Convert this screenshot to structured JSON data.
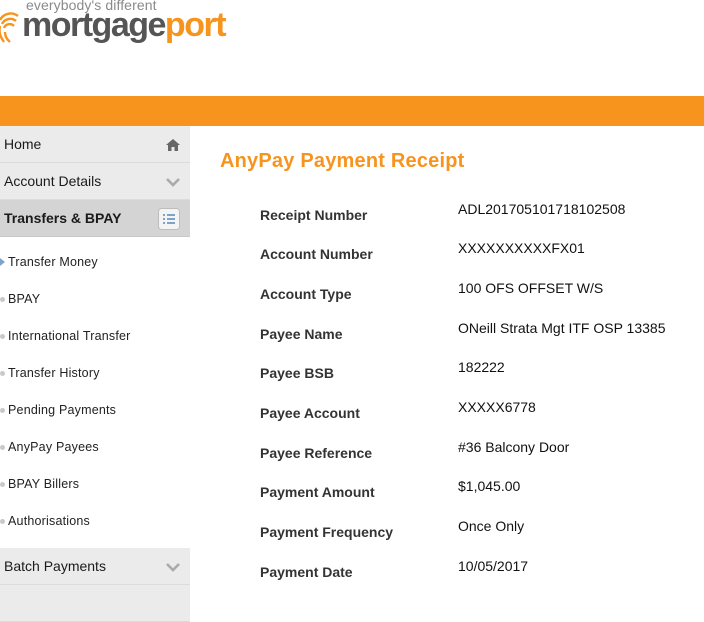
{
  "logo": {
    "tagline": "everybody's different",
    "name_dark": "mortgage",
    "name_orange": "port"
  },
  "colors": {
    "accent": "#f7941d",
    "nav_bg": "#ebebeb",
    "nav_active_bg": "#d4d4d4"
  },
  "sidebar": {
    "top_items": [
      {
        "label": "Home",
        "icon": "home-icon"
      },
      {
        "label": "Account Details",
        "icon": "chevron-down-icon"
      },
      {
        "label": "Transfers & BPAY",
        "icon": "list-icon",
        "active": true
      }
    ],
    "sub_items": [
      "Transfer Money",
      "BPAY",
      "International Transfer",
      "Transfer History",
      "Pending Payments",
      "AnyPay Payees",
      "BPAY Billers",
      "Authorisations"
    ],
    "bottom_items": [
      {
        "label": "Batch Payments",
        "icon": "chevron-down-icon"
      }
    ]
  },
  "receipt": {
    "title": "AnyPay Payment Receipt",
    "rows": [
      {
        "label": "Receipt Number",
        "value": "ADL20170510171810250​8"
      },
      {
        "label": "Account Number",
        "value": "XXXXXXXXXXFX01"
      },
      {
        "label": "Account Type",
        "value": "100 OFS OFFSET W/S"
      },
      {
        "label": "Payee Name",
        "value": "ONeill Strata Mgt ITF OSP 13385"
      },
      {
        "label": "Payee BSB",
        "value": "182222"
      },
      {
        "label": "Payee Account",
        "value": "XXXXX6778"
      },
      {
        "label": "Payee Reference",
        "value": "#36 Balcony Door"
      },
      {
        "label": "Payment Amount",
        "value": "$1,045.00"
      },
      {
        "label": "Payment Frequency",
        "value": "Once Only"
      },
      {
        "label": "Payment Date",
        "value": "10/05/2017"
      }
    ]
  }
}
